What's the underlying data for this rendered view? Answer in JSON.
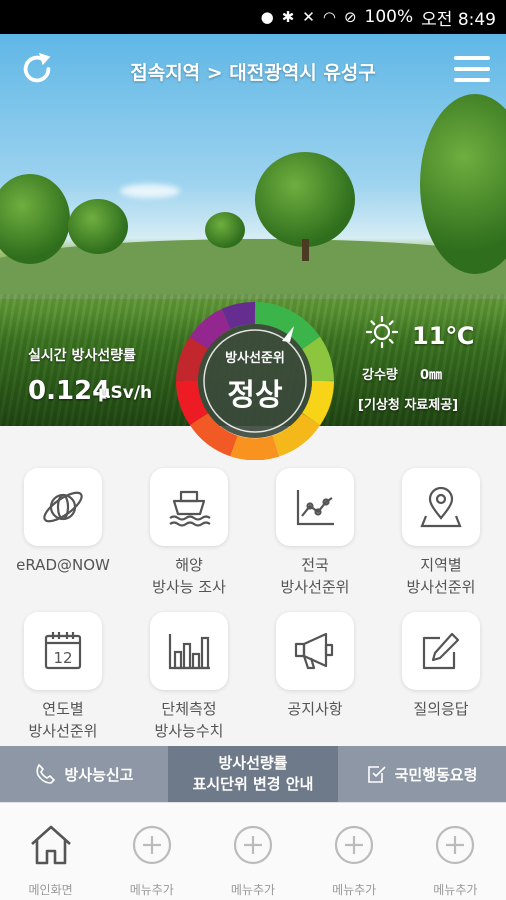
{
  "status_bar": {
    "battery": "100%",
    "time": "오전 8:49"
  },
  "header": {
    "title": "접속지역 > 대전광역시 유성구"
  },
  "realtime": {
    "label": "실시간 방사선량률",
    "value": "0.124",
    "unit": "μSv/h"
  },
  "gauge": {
    "label": "방사선준위",
    "status": "정상"
  },
  "weather": {
    "temp": "11℃",
    "rain_label": "강수량",
    "rain_value": "0㎜",
    "source": "[기상청 자료제공]"
  },
  "menu": [
    {
      "label": "eRAD@NOW",
      "icon": "globe-icon"
    },
    {
      "label": "해양\n방사능 조사",
      "icon": "ship-icon"
    },
    {
      "label": "전국\n방사선준위",
      "icon": "line-chart-icon"
    },
    {
      "label": "지역별\n방사선준위",
      "icon": "map-pin-icon"
    },
    {
      "label": "연도별\n방사선준위",
      "icon": "calendar-icon"
    },
    {
      "label": "단체측정\n방사능수치",
      "icon": "bar-chart-icon"
    },
    {
      "label": "공지사항",
      "icon": "megaphone-icon"
    },
    {
      "label": "질의응답",
      "icon": "edit-icon"
    }
  ],
  "strip": {
    "report": "방사능신고",
    "notice_line1": "방사선량률",
    "notice_line2": "표시단위 변경 안내",
    "guide": "국민행동요령"
  },
  "nav": [
    {
      "label": "메인화면",
      "icon": "home-icon"
    },
    {
      "label": "메뉴추가",
      "icon": "plus-circle-icon"
    },
    {
      "label": "메뉴추가",
      "icon": "plus-circle-icon"
    },
    {
      "label": "메뉴추가",
      "icon": "plus-circle-icon"
    },
    {
      "label": "메뉴추가",
      "icon": "plus-circle-icon"
    }
  ]
}
